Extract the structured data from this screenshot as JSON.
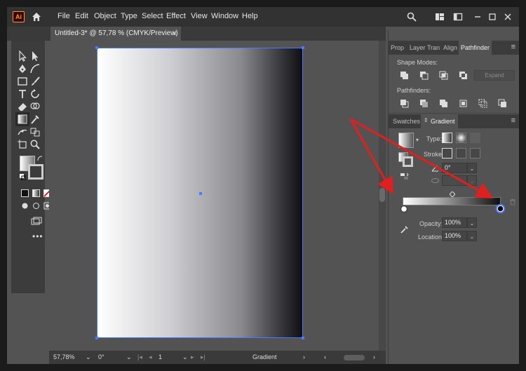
{
  "app": {
    "logo_text": "Ai",
    "colors": {
      "accent_blue": "#4a7bff",
      "arrow_red": "#e0201e",
      "logo_orange": "#ff9a00"
    }
  },
  "menu": {
    "items": [
      "File",
      "Edit",
      "Object",
      "Type",
      "Select",
      "Effect",
      "View",
      "Window",
      "Help"
    ]
  },
  "document_tab": {
    "title": "Untitled-3* @ 57,78 % (CMYK/Preview)",
    "close_glyph": "×"
  },
  "status_bar": {
    "zoom": "57,78%",
    "rotation": "0°",
    "artboard_number": "1",
    "current_tool": "Gradient"
  },
  "panels": {
    "top_tabs": [
      "Prop",
      "Layer",
      "Tran",
      "Align",
      "Pathfinder"
    ],
    "active_top_tab": "Pathfinder",
    "shape_modes_label": "Shape Modes:",
    "expand_label": "Expand",
    "pathfinders_label": "Pathfinders:",
    "second_tabs": [
      "Swatches",
      "Gradient"
    ],
    "active_second_tab": "Gradient"
  },
  "gradient": {
    "type_label": "Type:",
    "stroke_label": "Stroke:",
    "angle": "0°",
    "aspect": "",
    "opacity_label": "Opacity:",
    "opacity": "100%",
    "location_label": "Location:",
    "location": "100%",
    "start_color": "#ffffff",
    "end_color": "#000000"
  }
}
